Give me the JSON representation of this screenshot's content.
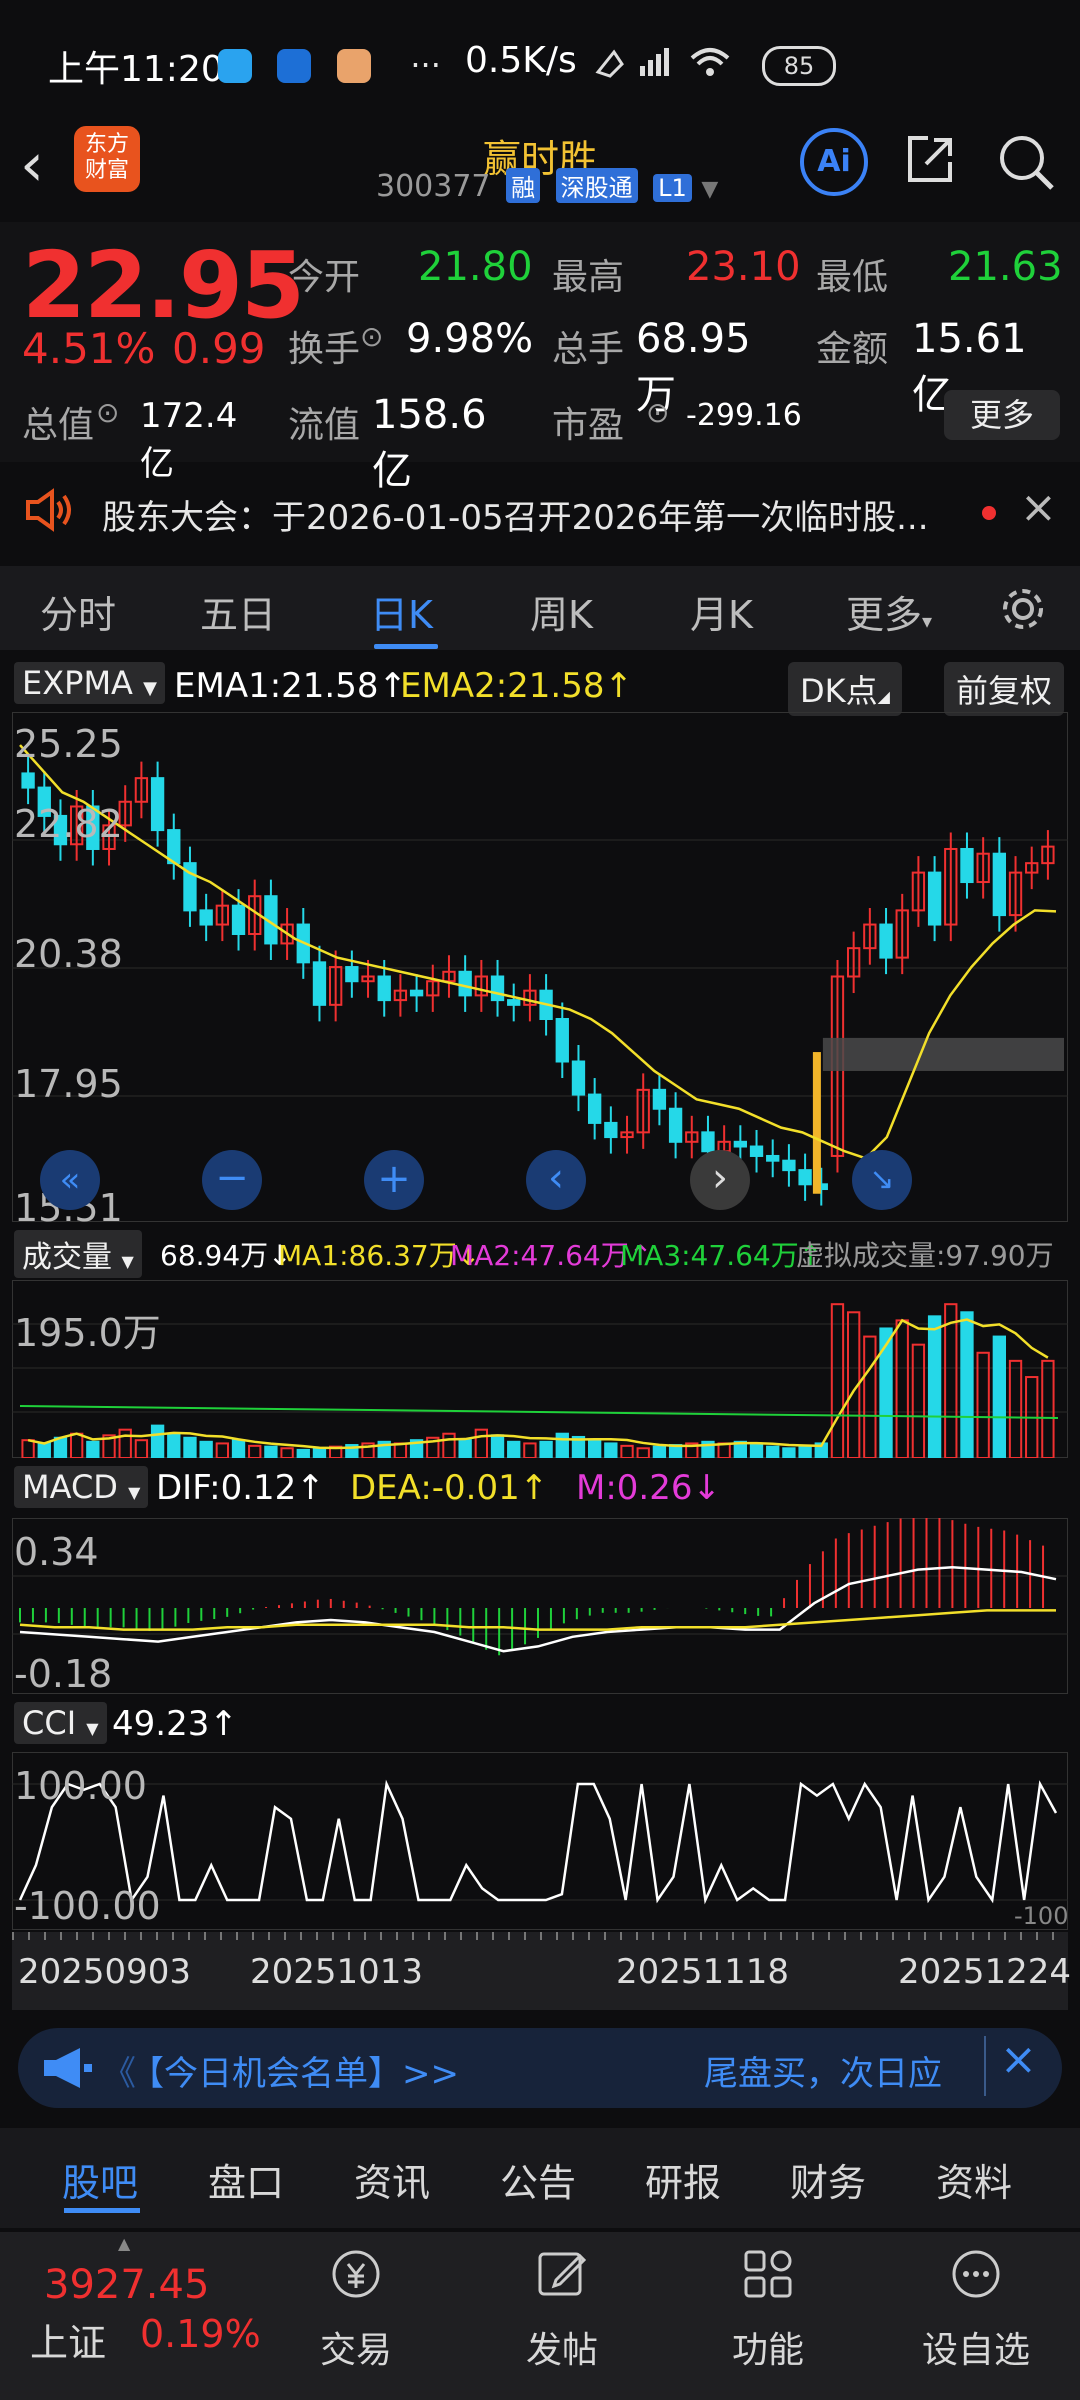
{
  "status_bar": {
    "time": "上午11:20",
    "more": "···",
    "speed": "0.5K/s",
    "battery": "85"
  },
  "header": {
    "logo_text_1": "东方",
    "logo_text_2": "财富",
    "stock_name": "赢时胜",
    "stock_code": "300377",
    "badges": [
      "融",
      "深股通",
      "L1"
    ],
    "ai_label": "Ai"
  },
  "quote": {
    "price": "22.95",
    "change_pct": "4.51%",
    "change": "0.99",
    "rows": [
      [
        {
          "label": "今开",
          "value": "21.80",
          "color": "green"
        },
        {
          "label": "最高",
          "value": "23.10",
          "color": "red"
        },
        {
          "label": "最低",
          "value": "21.63",
          "color": "green"
        }
      ],
      [
        {
          "label": "换手",
          "value": "9.98%",
          "color": "white"
        },
        {
          "label": "总手",
          "value": "68.95万",
          "color": "white"
        },
        {
          "label": "金额",
          "value": "15.61亿",
          "color": "white"
        }
      ],
      [
        {
          "label": "总值",
          "value": "172.4亿",
          "color": "white"
        },
        {
          "label": "流值",
          "value": "158.6亿",
          "color": "white"
        },
        {
          "label": "市盈",
          "value": "-299.16",
          "color": "white"
        }
      ]
    ],
    "more_button": "更多"
  },
  "notice": {
    "text": "股东大会：于2026-01-05召开2026年第一次临时股..."
  },
  "tabs": [
    "分时",
    "五日",
    "日K",
    "周K",
    "月K",
    "更多"
  ],
  "active_tab": "日K",
  "main_chart": {
    "indicator": "EXPMA",
    "ema1": "EMA1:21.58",
    "ema2": "EMA2:21.58",
    "dk_button": "DK点",
    "adjust_button": "前复权",
    "y_labels": [
      "25.25",
      "22.82",
      "20.38",
      "17.95",
      "15.51"
    ]
  },
  "volume_panel": {
    "label": "成交量",
    "value": "68.94万",
    "ma1": "MA1:86.37万",
    "ma2": "MA2:47.64万",
    "ma3": "MA3:47.64万",
    "virtual": "虚拟成交量:97.90万",
    "y_label": "195.0万"
  },
  "macd_panel": {
    "label": "MACD",
    "dif": "DIF:0.12",
    "dea": "DEA:-0.01",
    "m": "M:0.26",
    "y_top": "0.34",
    "y_bottom": "-0.18"
  },
  "cci_panel": {
    "label": "CCI",
    "value": "49.23",
    "y_top": "100.00",
    "y_bottom": "-100.00",
    "y_right": "-100"
  },
  "dates": [
    "20250903",
    "20251013",
    "20251118",
    "20251224"
  ],
  "banner": {
    "left": "【今日机会名单】>>",
    "right": "尾盘买，次日应"
  },
  "subtabs": [
    "股吧",
    "盘口",
    "资讯",
    "公告",
    "研报",
    "财务",
    "资料"
  ],
  "active_subtab": "股吧",
  "bottom": {
    "index_value": "3927.45",
    "index_name": "上证",
    "index_pct": "0.19%",
    "items": [
      "交易",
      "发帖",
      "功能",
      "设自选"
    ]
  },
  "chart_data": {
    "type": "candlestick",
    "y_range": [
      15.51,
      25.25
    ],
    "close": [
      24.2,
      23.6,
      23.0,
      23.8,
      22.9,
      23.4,
      23.9,
      24.4,
      23.3,
      22.6,
      21.6,
      21.3,
      21.7,
      21.1,
      21.9,
      20.9,
      21.3,
      20.5,
      19.6,
      20.4,
      20.1,
      20.2,
      19.7,
      19.9,
      19.8,
      20.1,
      20.3,
      19.8,
      20.2,
      19.7,
      19.6,
      19.9,
      19.3,
      18.4,
      17.7,
      17.1,
      16.8,
      16.9,
      17.8,
      17.4,
      16.7,
      16.9,
      16.5,
      16.7,
      16.6,
      16.4,
      16.3,
      16.1,
      15.8,
      15.7,
      20.2,
      20.8,
      21.3,
      20.6,
      21.6,
      22.4,
      21.3,
      22.9,
      22.2,
      22.8,
      21.5,
      22.4,
      22.6,
      22.95
    ],
    "ema": [
      25.1,
      24.6,
      24.1,
      23.9,
      23.6,
      23.3,
      23.0,
      22.7,
      22.4,
      22.2,
      21.9,
      21.6,
      21.3,
      21.0,
      20.8,
      20.6,
      20.5,
      20.4,
      20.3,
      20.2,
      20.1,
      20.0,
      19.9,
      19.8,
      19.7,
      19.6,
      19.5,
      19.3,
      19.0,
      18.6,
      18.2,
      17.9,
      17.6,
      17.5,
      17.4,
      17.2,
      17.0,
      16.9,
      16.7,
      16.5,
      16.35,
      16.8,
      17.9,
      19.0,
      19.8,
      20.4,
      20.9,
      21.3,
      21.6,
      21.58
    ],
    "volume_wan": [
      22,
      18,
      25,
      30,
      20,
      28,
      35,
      22,
      40,
      30,
      25,
      20,
      18,
      22,
      15,
      14,
      12,
      10,
      12,
      14,
      16,
      18,
      20,
      18,
      22,
      25,
      30,
      22,
      35,
      28,
      20,
      18,
      20,
      30,
      26,
      22,
      18,
      15,
      12,
      14,
      16,
      18,
      20,
      18,
      20,
      16,
      14,
      12,
      15,
      18,
      190,
      180,
      150,
      160,
      170,
      140,
      175,
      190,
      180,
      130,
      150,
      120,
      100,
      120
    ],
    "macd": {
      "dif": [
        -0.1,
        -0.11,
        -0.12,
        -0.13,
        -0.14,
        -0.12,
        -0.1,
        -0.08,
        -0.06,
        -0.05,
        -0.06,
        -0.08,
        -0.1,
        -0.14,
        -0.18,
        -0.16,
        -0.12,
        -0.1,
        -0.09,
        -0.08,
        -0.08,
        -0.09,
        -0.09,
        0.02,
        0.1,
        0.13,
        0.16,
        0.17,
        0.16,
        0.15,
        0.12
      ],
      "dea": [
        -0.07,
        -0.08,
        -0.08,
        -0.09,
        -0.09,
        -0.09,
        -0.08,
        -0.08,
        -0.07,
        -0.07,
        -0.07,
        -0.07,
        -0.07,
        -0.08,
        -0.08,
        -0.09,
        -0.09,
        -0.09,
        -0.08,
        -0.08,
        -0.08,
        -0.08,
        -0.07,
        -0.06,
        -0.05,
        -0.04,
        -0.03,
        -0.02,
        -0.01,
        -0.01,
        -0.01
      ]
    },
    "cci": [
      -100,
      -40,
      60,
      100,
      90,
      100,
      60,
      -100,
      -60,
      80,
      -100,
      -100,
      -40,
      -100,
      -100,
      -100,
      60,
      40,
      -100,
      -100,
      40,
      -100,
      -100,
      100,
      40,
      -100,
      -100,
      -100,
      -40,
      -80,
      -100,
      -100,
      -100,
      -100,
      -90,
      100,
      100,
      40,
      -100,
      100,
      -100,
      -60,
      100,
      -100,
      -40,
      -100,
      -80,
      -100,
      -100,
      100,
      80,
      100,
      40,
      100,
      60,
      -100,
      80,
      -100,
      -60,
      60,
      -60,
      -100,
      100,
      -100,
      100,
      50
    ]
  }
}
